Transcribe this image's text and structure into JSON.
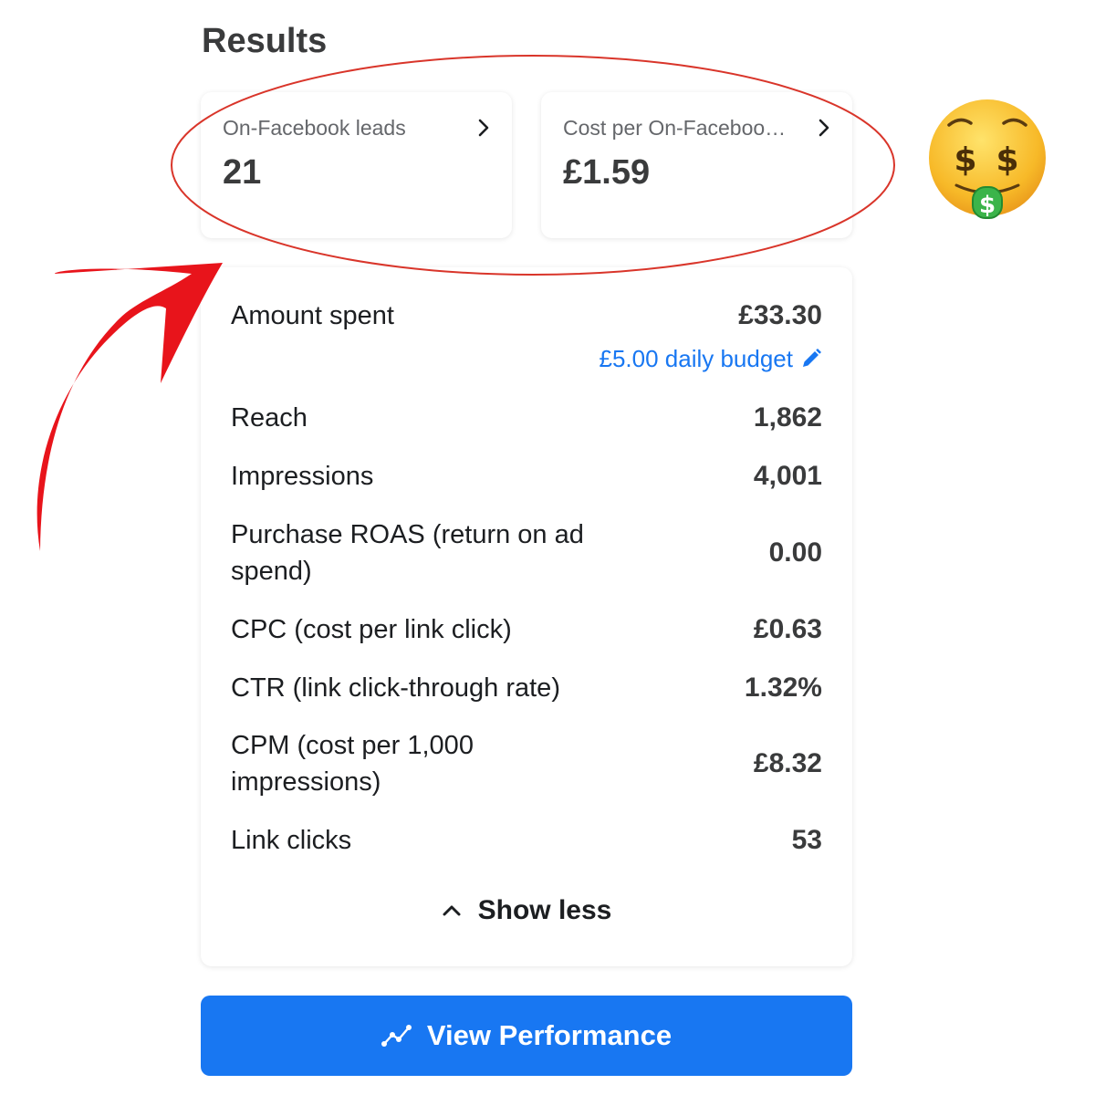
{
  "results": {
    "title": "Results",
    "kpis": [
      {
        "label": "On-Facebook leads",
        "value": "21"
      },
      {
        "label": "Cost per On-Faceboo…",
        "value": "£1.59"
      }
    ]
  },
  "metrics": {
    "amount_spent": {
      "label": "Amount spent",
      "value": "£33.30",
      "budget_link": "£5.00 daily budget"
    },
    "rows": [
      {
        "label": "Reach",
        "value": "1,862"
      },
      {
        "label": "Impressions",
        "value": "4,001"
      },
      {
        "label": "Purchase ROAS (return on ad spend)",
        "value": "0.00"
      },
      {
        "label": "CPC (cost per link click)",
        "value": "£0.63"
      },
      {
        "label": "CTR (link click-through rate)",
        "value": "1.32%"
      },
      {
        "label": "CPM (cost per 1,000 impressions)",
        "value": "£8.32"
      },
      {
        "label": "Link clicks",
        "value": "53"
      }
    ],
    "toggle_label": "Show less"
  },
  "cta": {
    "label": "View Performance"
  },
  "annotation": {
    "ellipse_color": "#d9352a",
    "arrow_color": "#e8141b"
  },
  "colors": {
    "accent": "#1877f2"
  },
  "icons": [
    "chevron-right-icon",
    "pencil-icon",
    "chevron-up-icon",
    "trend-line-icon",
    "money-mouth-face-emoji"
  ]
}
